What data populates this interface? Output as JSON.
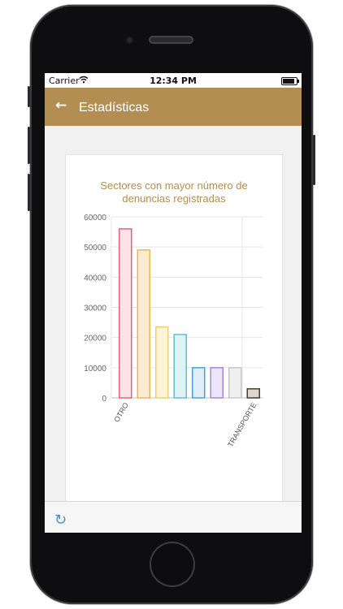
{
  "status_bar": {
    "carrier": "Carrier",
    "time": "12:34 PM"
  },
  "app_bar": {
    "back_icon": "arrow-left-icon",
    "title": "Estadísticas"
  },
  "bottom_bar": {
    "refresh_icon": "refresh-icon"
  },
  "colors": {
    "brand": "#b38e52",
    "title_text": "#b38e52",
    "accent_blue": "#4a90d9"
  },
  "chart_data": {
    "type": "bar",
    "title": "Sectores con mayor número de denuncias registradas",
    "title_lines": [
      "Sectores con mayor número de",
      "denuncias registradas"
    ],
    "categories": [
      "OTRO",
      "",
      "",
      "",
      "",
      "",
      "",
      "TRANSPORTE"
    ],
    "values": [
      56000,
      49000,
      23500,
      21000,
      10000,
      10000,
      10000,
      3000
    ],
    "ylim": [
      0,
      60000
    ],
    "yticks": [
      0,
      10000,
      20000,
      30000,
      40000,
      50000,
      60000
    ],
    "grid": true,
    "legend": "none",
    "series_colors": [
      {
        "stroke": "#e8607a",
        "fill": "#fde3e8"
      },
      {
        "stroke": "#efb45c",
        "fill": "#fdebd2"
      },
      {
        "stroke": "#f0cf6e",
        "fill": "#fff4d6"
      },
      {
        "stroke": "#5fc2cb",
        "fill": "#dff3f4"
      },
      {
        "stroke": "#4aa0e2",
        "fill": "#e0eefa"
      },
      {
        "stroke": "#a884e6",
        "fill": "#ede5fb"
      },
      {
        "stroke": "#c9c9cd",
        "fill": "#efefef"
      },
      {
        "stroke": "#4a3c30",
        "fill": "#dbd6d1"
      }
    ]
  }
}
